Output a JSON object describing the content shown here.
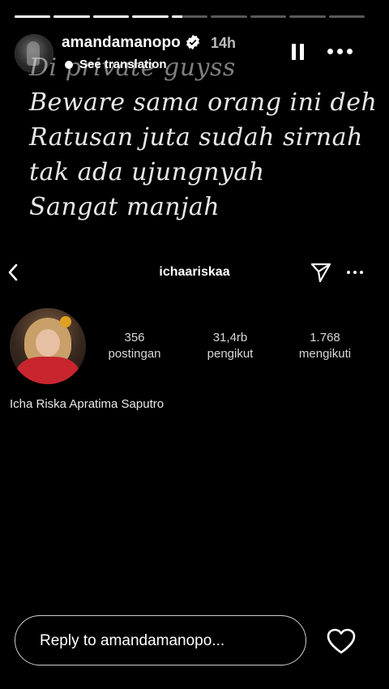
{
  "progress": {
    "segments": 9,
    "current_index": 4,
    "current_fraction": 0.3
  },
  "header": {
    "username": "amandamanopo",
    "time": "14h",
    "see_translation": "See translation",
    "avatar_icon": "profile-avatar-icon",
    "verified_icon": "verified-badge-icon",
    "pause_icon": "pause-icon",
    "more_icon": "more-horizontal-icon"
  },
  "story_text": {
    "lines": [
      "Di private guyss",
      "Beware sama orang ini deh",
      "Ratusan juta sudah sirnah",
      "tak ada ujungnyah",
      "Sangat manjah"
    ]
  },
  "profile": {
    "handle": "ichaariskaa",
    "back_icon": "chevron-left-icon",
    "send_icon": "send-direct-icon",
    "more_icon": "more-horizontal-icon",
    "stats": [
      {
        "value": "356",
        "label": "postingan"
      },
      {
        "value": "31,4rb",
        "label": "pengikut"
      },
      {
        "value": "1.768",
        "label": "mengikuti"
      }
    ],
    "full_name": "Icha Riska Apratima Saputro"
  },
  "reply": {
    "placeholder": "Reply to amandamanopo...",
    "heart_icon": "heart-icon"
  },
  "colors": {
    "background": "#000000",
    "text": "#ffffff",
    "muted": "#bdbdbd"
  }
}
